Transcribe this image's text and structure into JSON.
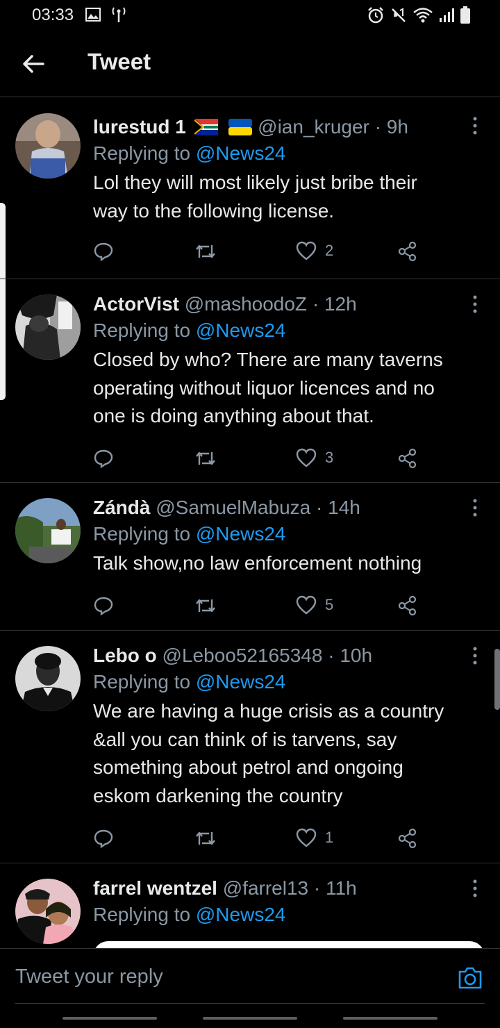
{
  "status_bar": {
    "time": "03:33",
    "left_icons": [
      "gallery-icon",
      "antenna-icon"
    ],
    "right_icons": [
      "alarm-icon",
      "mute-icon",
      "wifi-icon",
      "signal-icon",
      "battery-icon"
    ]
  },
  "header": {
    "title": "Tweet",
    "back_icon": "arrow-left-icon"
  },
  "tweets": [
    {
      "name": "lurestud 1",
      "flags": [
        "south-africa-flag",
        "ukraine-flag"
      ],
      "handle": "@ian_kruger",
      "time": "9h",
      "replying_prefix": "Replying to",
      "replying_to": "@News24",
      "text_lines": [
        "Lol they will most likely just bribe their",
        "way to the following license."
      ],
      "likes": "2",
      "avatar": "avatar-lurestud"
    },
    {
      "name": "ActorVist",
      "flags": [],
      "handle": "@mashoodoZ",
      "time": "12h",
      "replying_prefix": "Replying to",
      "replying_to": "@News24",
      "text_lines": [
        "Closed by who? There are many taverns",
        "operating without liquor licences and no",
        "one is doing anything about that."
      ],
      "likes": "3",
      "avatar": "avatar-actorvist"
    },
    {
      "name": "Zándà",
      "flags": [],
      "handle": "@SamuelMabuza",
      "time": "14h",
      "replying_prefix": "Replying to",
      "replying_to": "@News24",
      "text_lines": [
        "Talk show,no law enforcement nothing"
      ],
      "likes": "5",
      "avatar": "avatar-zanda"
    },
    {
      "name": "Lebo o",
      "flags": [],
      "handle": "@Leboo52165348",
      "time": "10h",
      "replying_prefix": "Replying to",
      "replying_to": "@News24",
      "text_lines": [
        "We are having a huge crisis as a country",
        "&all you can think of is tarvens, say",
        "something about petrol and ongoing",
        "eskom darkening the country"
      ],
      "likes": "1",
      "avatar": "avatar-lebo"
    },
    {
      "name": "farrel wentzel",
      "flags": [],
      "handle": "@farrel13",
      "time": "11h",
      "replying_prefix": "Replying to",
      "replying_to": "@News24",
      "text_lines": [],
      "likes": "",
      "avatar": "avatar-farrel"
    }
  ],
  "reply_bar": {
    "placeholder": "Tweet your reply",
    "camera_icon": "camera-icon"
  },
  "colors": {
    "background": "#000000",
    "text": "#e7e9ea",
    "muted": "#8b98a5",
    "link": "#1d9bf0",
    "divider": "#2f3336"
  }
}
